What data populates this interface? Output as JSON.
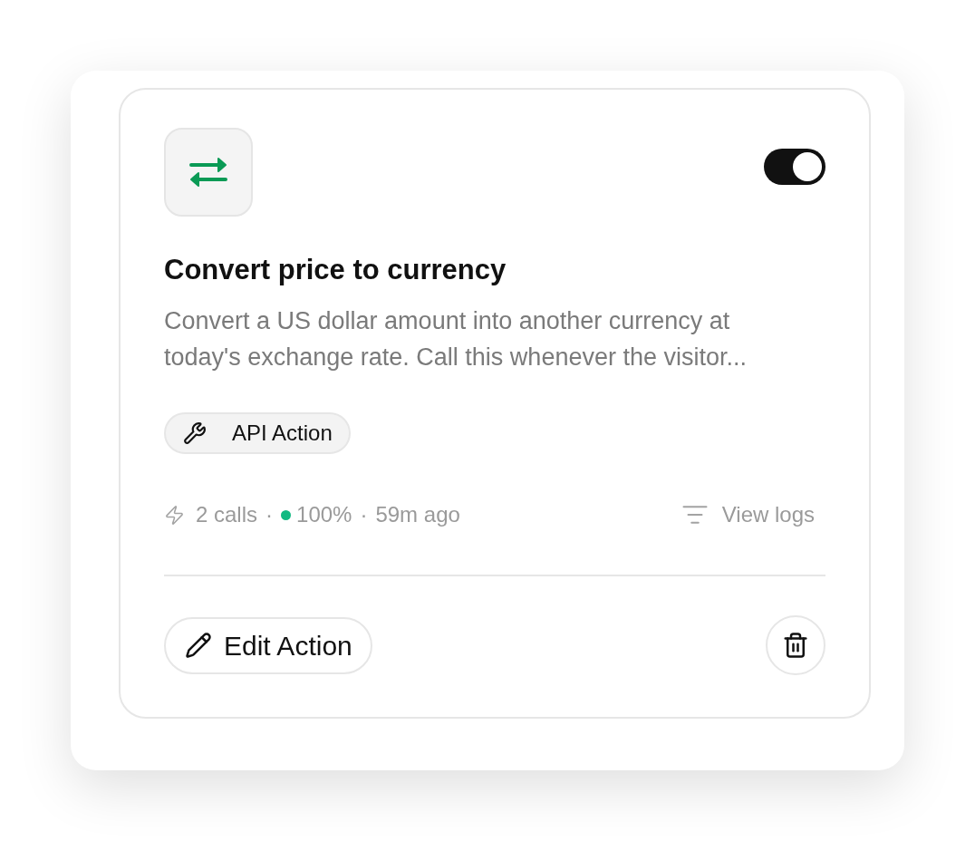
{
  "card": {
    "enabled": {
      "on": true
    },
    "title": "Convert price to currency",
    "description": "Convert a US dollar amount into another currency at today's exchange rate. Call this whenever the visitor...",
    "tag": {
      "label": "API Action"
    },
    "meta": [
      {
        "kind": "calls",
        "text": "2 calls"
      },
      {
        "kind": "separator",
        "text": "·"
      },
      {
        "kind": "rate",
        "text": "100%"
      },
      {
        "kind": "separator",
        "text": "·"
      },
      {
        "kind": "time",
        "text": "59m ago"
      }
    ],
    "view_logs": "View logs",
    "edit_button": "Edit Action"
  }
}
